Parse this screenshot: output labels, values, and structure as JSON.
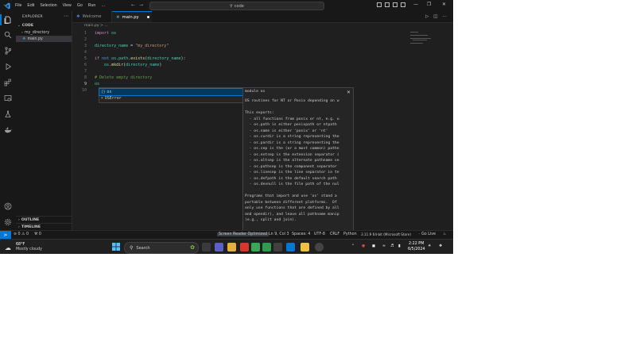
{
  "titlebar": {
    "menu": [
      "File",
      "Edit",
      "Selection",
      "View",
      "Go",
      "Run",
      "…"
    ],
    "command_center": "code"
  },
  "sidebar": {
    "title": "EXPLORER",
    "root": "CODE",
    "items": [
      {
        "label": "my_directory",
        "type": "folder"
      },
      {
        "label": "main.py",
        "type": "python"
      }
    ],
    "outline": "OUTLINE",
    "timeline": "TIMELINE"
  },
  "tabs": [
    {
      "label": "Welcome",
      "active": false
    },
    {
      "label": "main.py",
      "active": true,
      "modified": true
    }
  ],
  "breadcrumb": "main.py > ...",
  "code": [
    {
      "n": "1",
      "text": "import os"
    },
    {
      "n": "2",
      "text": ""
    },
    {
      "n": "3",
      "text": "directory_name = \"my_directory\""
    },
    {
      "n": "4",
      "text": ""
    },
    {
      "n": "5",
      "text": "if not os.path.exists(directory_name):"
    },
    {
      "n": "6",
      "text": "    os.mkdir(directory_name)"
    },
    {
      "n": "7",
      "text": ""
    },
    {
      "n": "8",
      "text": "# Delete empty directory"
    },
    {
      "n": "9",
      "text": "os"
    },
    {
      "n": "10",
      "text": ""
    }
  ],
  "suggest": {
    "items": [
      {
        "icon": "{}",
        "label": "os"
      },
      {
        "icon": "⌘",
        "label": "OSError"
      }
    ],
    "detail_header": "module os",
    "detail_lines": [
      "OS routines for NT or Posix depending on w",
      "",
      "This exports:",
      "  - all functions from posix or nt, e.g. u",
      "  - os.path is either posixpath or ntpath",
      "  - os.name is either 'posix' or 'nt'",
      "  - os.curdir is a string representing the",
      "  - os.pardir is a string representing the",
      "  - os.sep is the (or a most common) pathn",
      "  - os.extsep is the extension separator (",
      "  - os.altsep is the alternate pathname se",
      "  - os.pathsep is the component separator",
      "  - os.linesep is the line separator in te",
      "  - os.defpath is the default search path",
      "  - os.devnull is the file path of the nul",
      "",
      "Programs that import and use 'os' stand a",
      "portable between different platforms.  Of",
      "only use functions that are defined by all",
      "and opendir), and leave all pathname manip",
      "(e.g., split and join)."
    ]
  },
  "statusbar": {
    "problems": "⊘ 0 ⚠ 0",
    "ports": "⚒ 0",
    "screen_reader": "Screen Reader Optimized",
    "position": "Ln 9, Col 3",
    "spaces": "Spaces: 4",
    "encoding": "UTF-8",
    "eol": "CRLF",
    "language": "Python",
    "interpreter": "3.11.9 64-bit (Microsoft Store)",
    "golive": "Go Live"
  },
  "taskbar": {
    "weather_temp": "68°F",
    "weather_desc": "Mostly cloudy",
    "search_placeholder": "Search",
    "time": "2:22 PM",
    "date": "6/5/2024"
  },
  "colors": {
    "accent": "#0078d4",
    "editor_bg": "#1f1f1f",
    "sidebar_bg": "#181818"
  }
}
